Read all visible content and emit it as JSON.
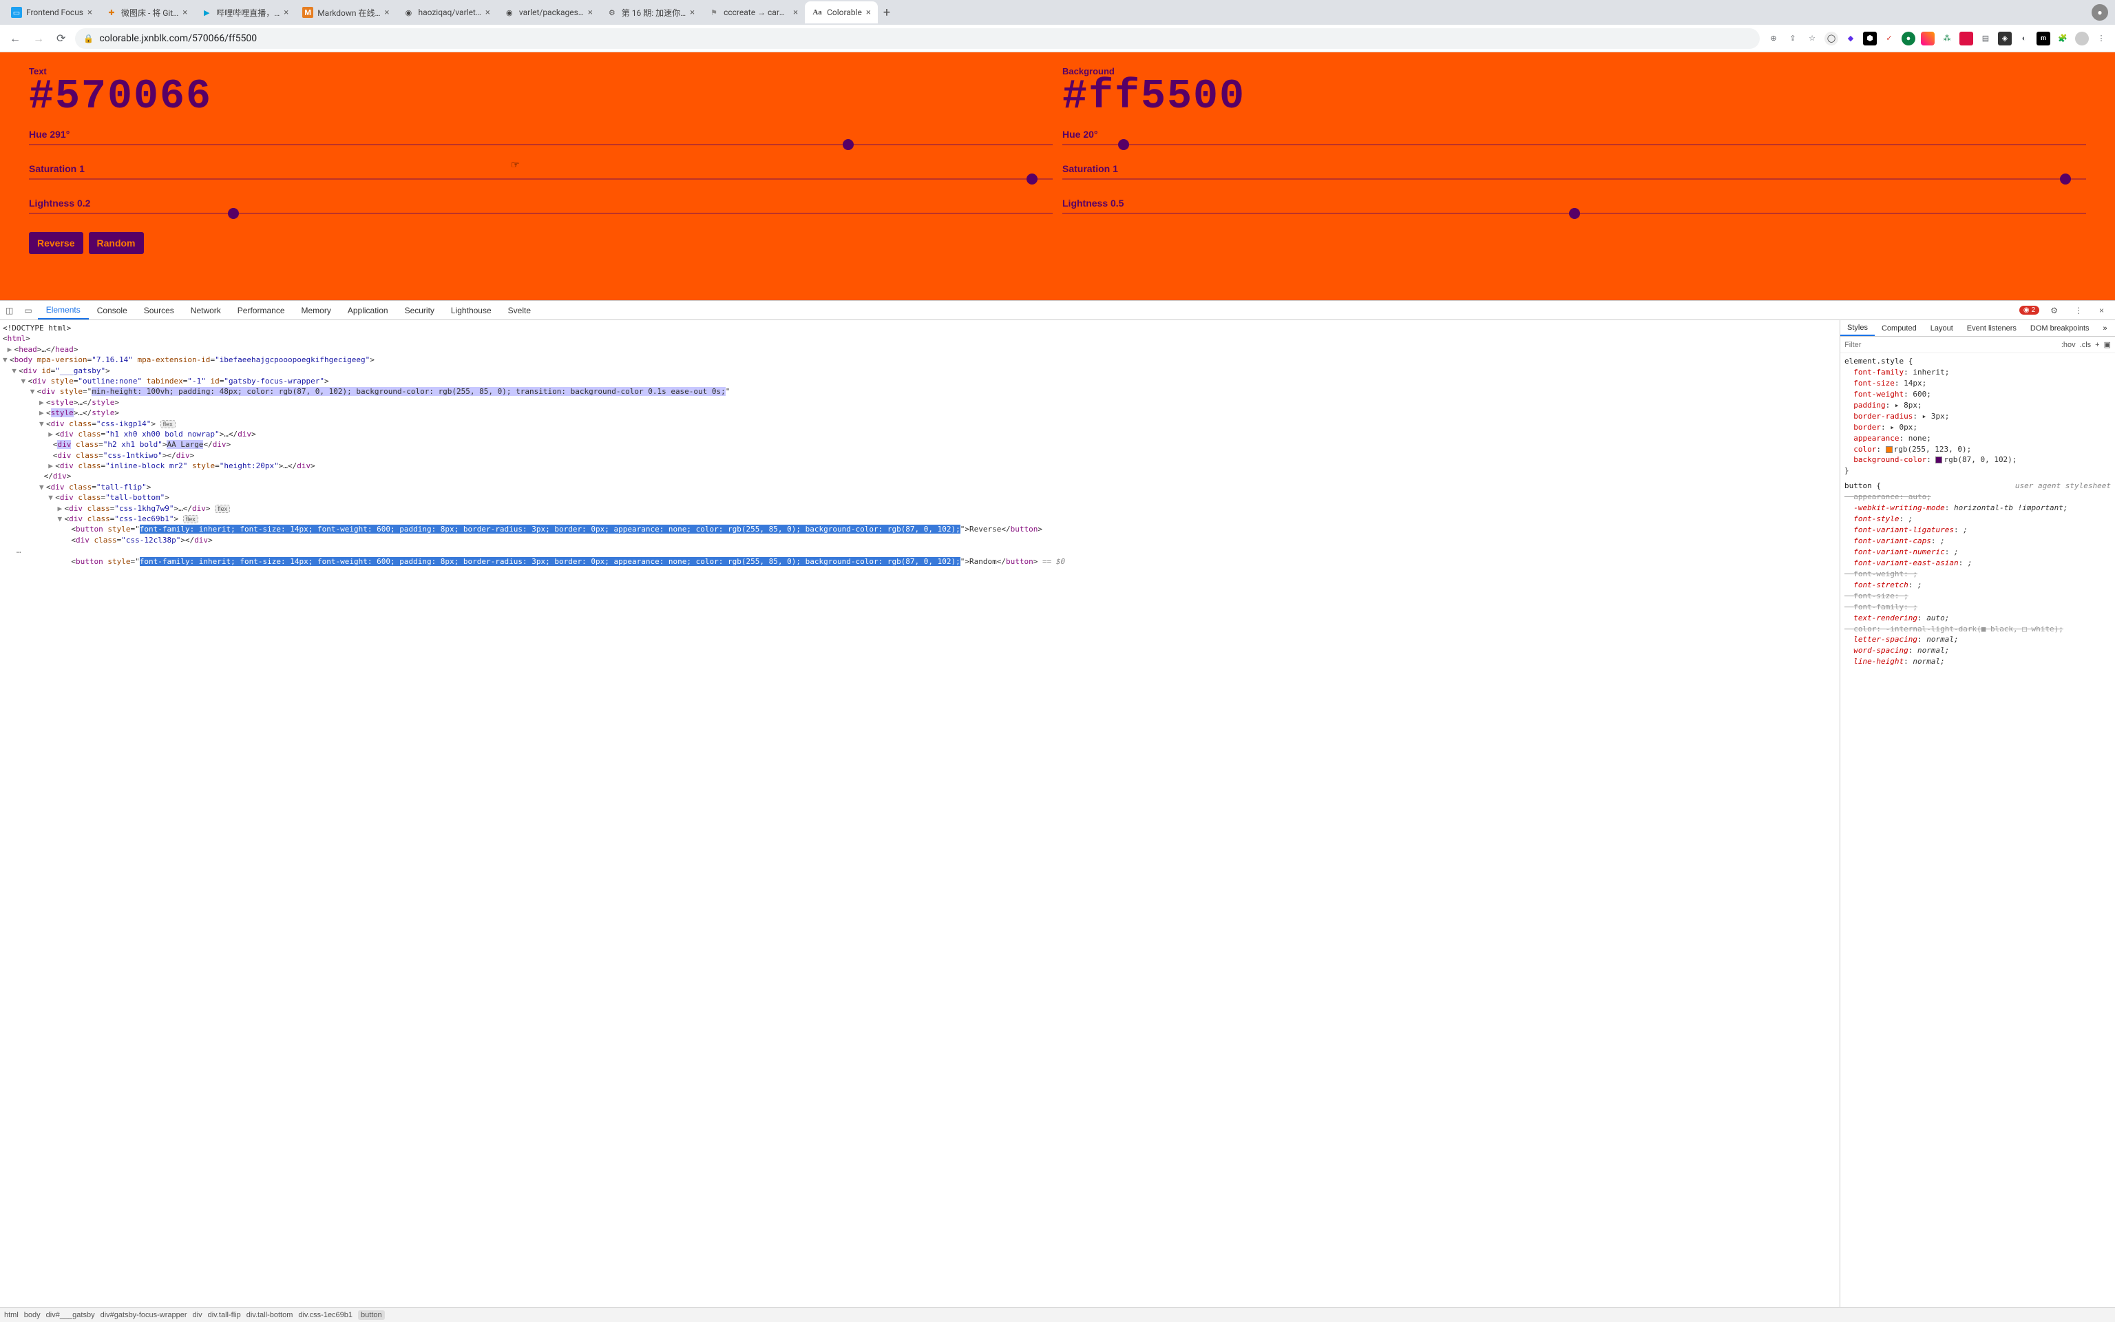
{
  "browser": {
    "tabs": [
      {
        "title": "Frontend Focus",
        "favicon": "📘"
      },
      {
        "title": "微图床 - 将 Git…",
        "favicon": "✖"
      },
      {
        "title": "哔哩哔哩直播，…",
        "favicon": "📺"
      },
      {
        "title": "Markdown 在线…",
        "favicon": "M"
      },
      {
        "title": "haoziqaq/varlet…",
        "favicon": "⊙"
      },
      {
        "title": "varlet/packages…",
        "favicon": "⊙"
      },
      {
        "title": "第 16 期: 加速你…",
        "favicon": "📄"
      },
      {
        "title": "cccreate → care…",
        "favicon": "⚑"
      },
      {
        "title": "Colorable",
        "favicon": "Aa",
        "active": true
      }
    ],
    "url": "colorable.jxnblk.com/570066/ff5500"
  },
  "app": {
    "text": {
      "label": "Text",
      "hex": "#570066",
      "hue_label": "Hue 291°",
      "hue_pct": 80,
      "sat_label": "Saturation 1",
      "sat_pct": 98,
      "light_label": "Lightness 0.2",
      "light_pct": 20
    },
    "bg": {
      "label": "Background",
      "hex": "#ff5500",
      "hue_label": "Hue 20°",
      "hue_pct": 6,
      "sat_label": "Saturation 1",
      "sat_pct": 98,
      "light_label": "Lightness 0.5",
      "light_pct": 50
    },
    "buttons": {
      "reverse": "Reverse",
      "random": "Random"
    }
  },
  "devtools": {
    "tabs": [
      "Elements",
      "Console",
      "Sources",
      "Network",
      "Performance",
      "Memory",
      "Application",
      "Security",
      "Lighthouse",
      "Svelte"
    ],
    "active_tab": "Elements",
    "error_count": "2",
    "styles_tabs": [
      "Styles",
      "Computed",
      "Layout",
      "Event listeners",
      "DOM breakpoints"
    ],
    "filter_placeholder": "Filter",
    "filter_chips": [
      ":hov",
      ".cls",
      "+"
    ],
    "breadcrumbs": [
      "html",
      "body",
      "div#___gatsby",
      "div#gatsby-focus-wrapper",
      "div",
      "div.tall-flip",
      "div.tall-bottom",
      "div.css-1ec69b1",
      "button"
    ],
    "dom": {
      "doctype": "<!DOCTYPE html>",
      "html_open": "<html>",
      "head": "<head>…</head>",
      "body_attrs": "mpa-version=\"7.16.14\" mpa-extension-id=\"ibefaeehajgcpooopoegkifhgecigeeg\"",
      "gatsby_id": "___gatsby",
      "focus_wrapper": "outline:none",
      "focus_tabindex": "-1",
      "focus_id": "gatsby-focus-wrapper",
      "main_div_style": "min-height: 100vh; padding: 48px; color: rgb(87, 0, 102); background-color: rgb(255, 85, 0); transition: background-color 0.1s ease-out 0s;",
      "css_ikgp14": "css-ikgp14",
      "h1_class": "h1 xh0 xh00 bold nowrap",
      "h2_class": "h2 xh1 bold",
      "aa_large": "AA Large",
      "css_1ntkiwo": "css-1ntkiwo",
      "inline_block": "inline-block mr2",
      "inline_style": "height:20px",
      "tall_flip": "tall-flip",
      "tall_bottom": "tall-bottom",
      "css_1khg7w9": "css-1khg7w9",
      "css_1ec69b1": "css-1ec69b1",
      "btn_style": "font-family: inherit; font-size: 14px; font-weight: 600; padding: 8px; border-radius: 3px; border: 0px; appearance: none; color: rgb(255, 85, 0); background-color: rgb(87, 0, 102);",
      "reverse": "Reverse",
      "css_12cl38p": "css-12cl38p",
      "random": "Random"
    },
    "styles": {
      "element_style_selector": "element.style {",
      "element_style": [
        {
          "prop": "font-family",
          "val": "inherit;"
        },
        {
          "prop": "font-size",
          "val": "14px;"
        },
        {
          "prop": "font-weight",
          "val": "600;"
        },
        {
          "prop": "padding",
          "val": "▸ 8px;"
        },
        {
          "prop": "border-radius",
          "val": "▸ 3px;"
        },
        {
          "prop": "border",
          "val": "▸ 0px;"
        },
        {
          "prop": "appearance",
          "val": "none;"
        },
        {
          "prop": "color",
          "val": "rgb(255, 123, 0);",
          "swatch": "#ff7b00"
        },
        {
          "prop": "background-color",
          "val": "rgb(87, 0, 102);",
          "swatch": "#570066"
        }
      ],
      "button_selector": "button {",
      "button_origin": "user agent stylesheet",
      "button_rules": [
        {
          "prop": "appearance",
          "val": "auto;",
          "strike": true
        },
        {
          "prop": "-webkit-writing-mode",
          "val": "horizontal-tb !important;",
          "strike": false,
          "italic": true
        },
        {
          "prop": "font-style",
          "val": ";",
          "strike": false,
          "italic": true
        },
        {
          "prop": "font-variant-ligatures",
          "val": ";",
          "strike": false,
          "italic": true
        },
        {
          "prop": "font-variant-caps",
          "val": ";",
          "strike": false,
          "italic": true
        },
        {
          "prop": "font-variant-numeric",
          "val": ";",
          "strike": false,
          "italic": true
        },
        {
          "prop": "font-variant-east-asian",
          "val": ";",
          "strike": false,
          "italic": true
        },
        {
          "prop": "font-weight",
          "val": ";",
          "strike": true
        },
        {
          "prop": "font-stretch",
          "val": ";",
          "strike": false,
          "italic": true
        },
        {
          "prop": "font-size",
          "val": ";",
          "strike": true
        },
        {
          "prop": "font-family",
          "val": ";",
          "strike": true
        },
        {
          "prop": "text-rendering",
          "val": "auto;",
          "strike": false,
          "italic": true
        },
        {
          "prop": "color",
          "val": "-internal-light-dark(■ black, □ white);",
          "strike": true
        },
        {
          "prop": "letter-spacing",
          "val": "normal;",
          "strike": false,
          "italic": true
        },
        {
          "prop": "word-spacing",
          "val": "normal;",
          "strike": false,
          "italic": true
        },
        {
          "prop": "line-height",
          "val": "normal;",
          "strike": false,
          "italic": true
        }
      ]
    }
  }
}
